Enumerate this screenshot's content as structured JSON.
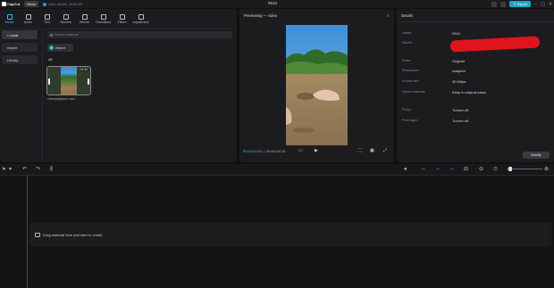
{
  "titlebar": {
    "app_name": "CapCut",
    "menu_label": "Menu",
    "autosave_text": "Auto saved: 20:00:25",
    "project_title": "0510",
    "export_label": "Export"
  },
  "toolbar": {
    "tabs": [
      {
        "label": "Media",
        "icon": "media-icon"
      },
      {
        "label": "Audio",
        "icon": "audio-icon"
      },
      {
        "label": "Text",
        "icon": "text-icon"
      },
      {
        "label": "Stickers",
        "icon": "stickers-icon"
      },
      {
        "label": "Effects",
        "icon": "effects-icon"
      },
      {
        "label": "Transitions",
        "icon": "transitions-icon"
      },
      {
        "label": "Filters",
        "icon": "filters-icon"
      },
      {
        "label": "Adjustment",
        "icon": "adjustment-icon"
      }
    ],
    "active_tab": "Media"
  },
  "media": {
    "sidenav": [
      "• Local",
      "Import",
      "Library"
    ],
    "search_placeholder": "Search material",
    "import_label": "Import",
    "sort_label": "Sort",
    "filter_label": "All",
    "all_label": "All",
    "clip": {
      "duration": "01:34",
      "name": "videoplayback.mp4"
    }
  },
  "player": {
    "header": "Previewing — video",
    "current_time": "00:00:00:00",
    "total_time": "00:01:34:15"
  },
  "details": {
    "header": "Details",
    "rows": [
      {
        "label": "Name:",
        "value": "0510"
      },
      {
        "label": "Saved:",
        "value": ""
      },
      {
        "label": "Ratio:",
        "value": "Original"
      },
      {
        "label": "Resolution:",
        "value": "Adapted"
      },
      {
        "label": "Frame rate:",
        "value": "30.00fps"
      },
      {
        "label": "Import material:",
        "value": "Keep in original place"
      },
      {
        "label": "Proxy:",
        "value": "Turned off"
      },
      {
        "label": "Free layer:",
        "value": "Turned off"
      }
    ],
    "modify_label": "Modify"
  },
  "timeline": {
    "drop_hint": "Drag material here and start to create"
  },
  "colors": {
    "accent": "#22c5e0",
    "export": "#1aa6c8",
    "redaction": "#e0141c"
  }
}
